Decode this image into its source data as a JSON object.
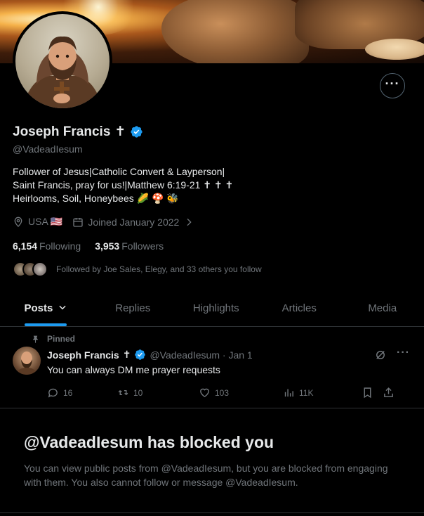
{
  "profile": {
    "display_name": "Joseph Francis",
    "cross_glyph": "✝",
    "handle": "@VadeadIesum",
    "bio_line1": "Follower of Jesus|Catholic Convert & Layperson|",
    "bio_line2": "Saint Francis, pray for us!|Matthew 6:19-21 ✝ ✝ ✝",
    "bio_line3": "Heirlooms, Soil, Honeybees 🌽 🍄 🐝",
    "location": "USA 🇺🇸",
    "joined": "Joined January 2022",
    "following_count": "6,154",
    "following_label": "Following",
    "followers_count": "3,953",
    "followers_label": "Followers",
    "followed_by": "Followed by Joe Sales, Elegy, and 33 others you follow",
    "more_label": "···"
  },
  "tabs": [
    {
      "label": "Posts",
      "active": true
    },
    {
      "label": "Replies",
      "active": false
    },
    {
      "label": "Highlights",
      "active": false
    },
    {
      "label": "Articles",
      "active": false
    },
    {
      "label": "Media",
      "active": false
    }
  ],
  "pinned_post": {
    "pinned_label": "Pinned",
    "author": "Joseph Francis",
    "cross_glyph": "✝",
    "handle_date": "@VadeadIesum · Jan 1",
    "text": "You can always DM me prayer requests",
    "replies": "16",
    "reposts": "10",
    "likes": "103",
    "views": "11K"
  },
  "blocked": {
    "title": "@VadeadIesum has blocked you",
    "body": "You can view public posts from @VadeadIesum, but you are blocked from engaging with them. You also cannot follow or message @VadeadIesum."
  },
  "colors": {
    "accent": "#1d9bf0",
    "muted": "#71767b",
    "text": "#e7e9ea",
    "background": "#000000",
    "border": "#2f3336"
  }
}
